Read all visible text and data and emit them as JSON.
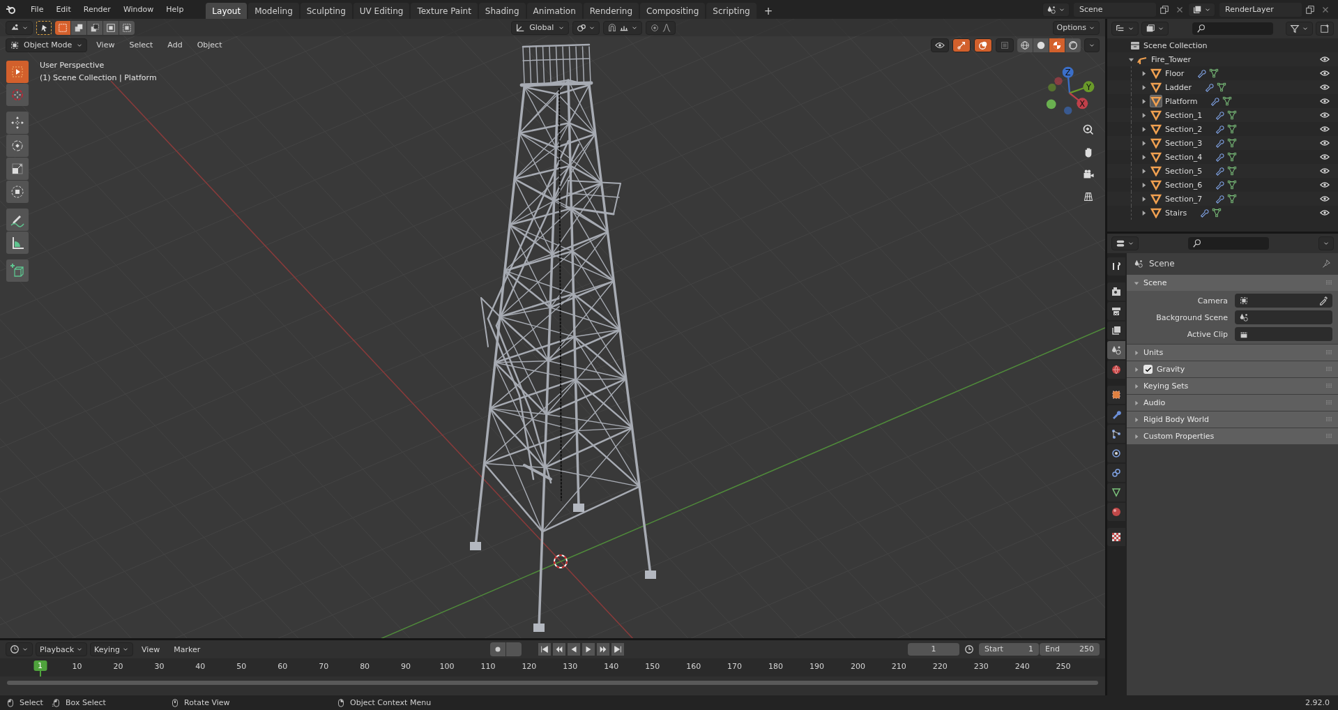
{
  "top_bar": {
    "menus": [
      "File",
      "Edit",
      "Render",
      "Window",
      "Help"
    ],
    "workspaces": [
      {
        "label": "Layout",
        "selected": true
      },
      {
        "label": "Modeling",
        "selected": false
      },
      {
        "label": "Sculpting",
        "selected": false
      },
      {
        "label": "UV Editing",
        "selected": false
      },
      {
        "label": "Texture Paint",
        "selected": false
      },
      {
        "label": "Shading",
        "selected": false
      },
      {
        "label": "Animation",
        "selected": false
      },
      {
        "label": "Rendering",
        "selected": false
      },
      {
        "label": "Compositing",
        "selected": false
      },
      {
        "label": "Scripting",
        "selected": false
      }
    ],
    "add_workspace": "+",
    "scene": "Scene",
    "view_layer": "RenderLayer"
  },
  "viewport": {
    "select_modes": [
      {
        "kind": "set",
        "selected": true
      },
      {
        "kind": "extend",
        "selected": false
      },
      {
        "kind": "subtract",
        "selected": false
      },
      {
        "kind": "invert",
        "selected": false
      },
      {
        "kind": "intersect",
        "selected": false
      }
    ],
    "orientation": "Global",
    "options": "Options",
    "mode": "Object Mode",
    "menus": [
      "View",
      "Select",
      "Add",
      "Object"
    ],
    "toggles": [
      {
        "kind": "visibility",
        "on": false
      },
      {
        "kind": "gizmo",
        "on": true
      },
      {
        "kind": "overlays",
        "on": true
      },
      {
        "kind": "xray",
        "on": false
      }
    ],
    "shading": [
      {
        "kind": "wireframe",
        "selected": false
      },
      {
        "kind": "solid",
        "selected": false
      },
      {
        "kind": "material",
        "selected": true
      },
      {
        "kind": "rendered",
        "selected": false
      }
    ],
    "overlay_text": [
      "User Perspective",
      "(1) Scene Collection | Platform"
    ],
    "gizmo_axes": [
      "Z",
      "Y",
      "X"
    ],
    "tools": [
      {
        "kind": "select",
        "selected": true
      },
      {
        "kind": "cursor",
        "selected": false
      },
      {
        "kind": "move",
        "selected": false
      },
      {
        "kind": "rotate",
        "selected": false
      },
      {
        "kind": "scale",
        "selected": false
      },
      {
        "kind": "transform",
        "selected": false
      },
      {
        "kind": "annotate",
        "selected": false
      },
      {
        "kind": "measure",
        "selected": false
      },
      {
        "kind": "add",
        "selected": false
      }
    ]
  },
  "outliner": {
    "root": "Scene Collection",
    "collections": [
      {
        "name": "Fire_Tower",
        "expanded": true,
        "children": [
          {
            "name": "Floor",
            "expanded": false,
            "selected": false
          },
          {
            "name": "Ladder",
            "expanded": false,
            "selected": false
          },
          {
            "name": "Platform",
            "expanded": false,
            "selected": true
          },
          {
            "name": "Section_1",
            "expanded": false,
            "selected": false
          },
          {
            "name": "Section_2",
            "expanded": false,
            "selected": false
          },
          {
            "name": "Section_3",
            "expanded": false,
            "selected": false
          },
          {
            "name": "Section_4",
            "expanded": false,
            "selected": false
          },
          {
            "name": "Section_5",
            "expanded": false,
            "selected": false
          },
          {
            "name": "Section_6",
            "expanded": false,
            "selected": false
          },
          {
            "name": "Section_7",
            "expanded": false,
            "selected": false
          },
          {
            "name": "Stairs",
            "expanded": false,
            "selected": false
          }
        ]
      }
    ]
  },
  "properties": {
    "tabs": [
      {
        "kind": "tool",
        "selected": false
      },
      {
        "kind": "render",
        "selected": false
      },
      {
        "kind": "output",
        "selected": false
      },
      {
        "kind": "viewlayer",
        "selected": false
      },
      {
        "kind": "scene",
        "selected": true
      },
      {
        "kind": "world",
        "selected": false
      },
      {
        "kind": "object",
        "selected": false
      },
      {
        "kind": "modifier",
        "selected": false
      },
      {
        "kind": "particles",
        "selected": false
      },
      {
        "kind": "physics",
        "selected": false
      },
      {
        "kind": "constraint",
        "selected": false
      },
      {
        "kind": "data",
        "selected": false
      },
      {
        "kind": "material",
        "selected": false
      },
      {
        "kind": "texture",
        "selected": false
      }
    ],
    "context": "Scene",
    "panels": [
      {
        "kind": "plain",
        "title": "Scene",
        "expanded": true,
        "fields": [
          {
            "label": "Camera",
            "kind": "camera"
          },
          {
            "label": "Background Scene",
            "kind": "scene"
          },
          {
            "label": "Active Clip",
            "kind": "clip"
          }
        ]
      },
      {
        "kind": "plain",
        "title": "Units",
        "expanded": false
      },
      {
        "kind": "toggle",
        "title": "Gravity",
        "expanded": false,
        "checked": true
      },
      {
        "kind": "plain",
        "title": "Keying Sets",
        "expanded": false
      },
      {
        "kind": "plain",
        "title": "Audio",
        "expanded": false
      },
      {
        "kind": "plain",
        "title": "Rigid Body World",
        "expanded": false
      },
      {
        "kind": "plain",
        "title": "Custom Properties",
        "expanded": false
      }
    ]
  },
  "timeline": {
    "menus": [
      "Playback",
      "Keying",
      "View",
      "Marker"
    ],
    "frame": "1",
    "start_label": "Start",
    "start": "1",
    "end_label": "End",
    "end": "250",
    "playhead": "1",
    "ruler": [
      "10",
      "20",
      "30",
      "40",
      "50",
      "60",
      "70",
      "80",
      "90",
      "100",
      "110",
      "120",
      "130",
      "140",
      "150",
      "160",
      "170",
      "180",
      "190",
      "200",
      "210",
      "220",
      "230",
      "240",
      "250"
    ]
  },
  "status_bar": {
    "items": [
      {
        "kind": "left",
        "label": "Select"
      },
      {
        "kind": "drag",
        "label": "Box Select"
      },
      {
        "kind": "middle",
        "label": "Rotate View"
      },
      {
        "kind": "right",
        "label": "Object Context Menu"
      }
    ],
    "version": "2.92.0"
  }
}
